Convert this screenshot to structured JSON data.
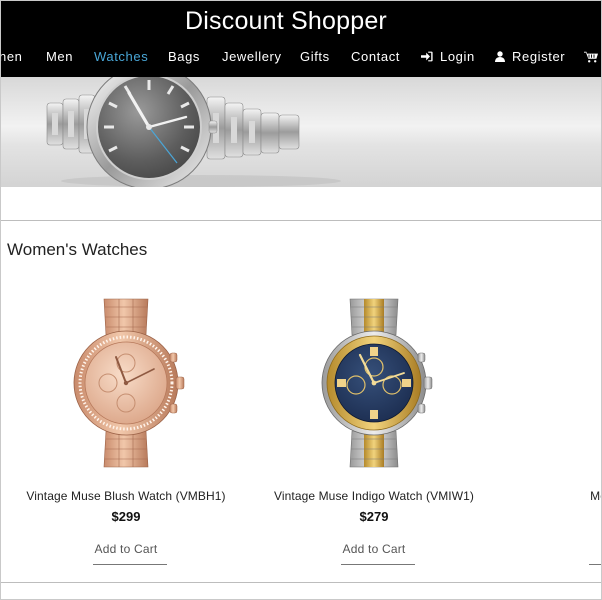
{
  "site": {
    "title": "Discount Shopper"
  },
  "nav": {
    "items": [
      {
        "label": "nen",
        "active": false
      },
      {
        "label": "Men",
        "active": false
      },
      {
        "label": "Watches",
        "active": true
      },
      {
        "label": "Bags",
        "active": false
      },
      {
        "label": "Jewellery",
        "active": false
      },
      {
        "label": "Gifts",
        "active": false
      },
      {
        "label": "Contact",
        "active": false
      }
    ],
    "login": {
      "label": "Login",
      "icon": "sign-in-icon"
    },
    "register": {
      "label": "Register",
      "icon": "user-icon"
    },
    "cart": {
      "icon": "cart-icon"
    }
  },
  "colors": {
    "header_bg": "#000000",
    "nav_active": "#49a6d6",
    "text": "#222222"
  },
  "section": {
    "title": "Women's Watches"
  },
  "products": [
    {
      "name": "Vintage Muse Blush Watch (VMBH1)",
      "price": "$299",
      "cta": "Add to Cart"
    },
    {
      "name": "Vintage Muse Indigo Watch (VMIW1)",
      "price": "$279",
      "cta": "Add to Cart"
    },
    {
      "name": "Modern Pur",
      "price": "",
      "cta": "A"
    }
  ]
}
